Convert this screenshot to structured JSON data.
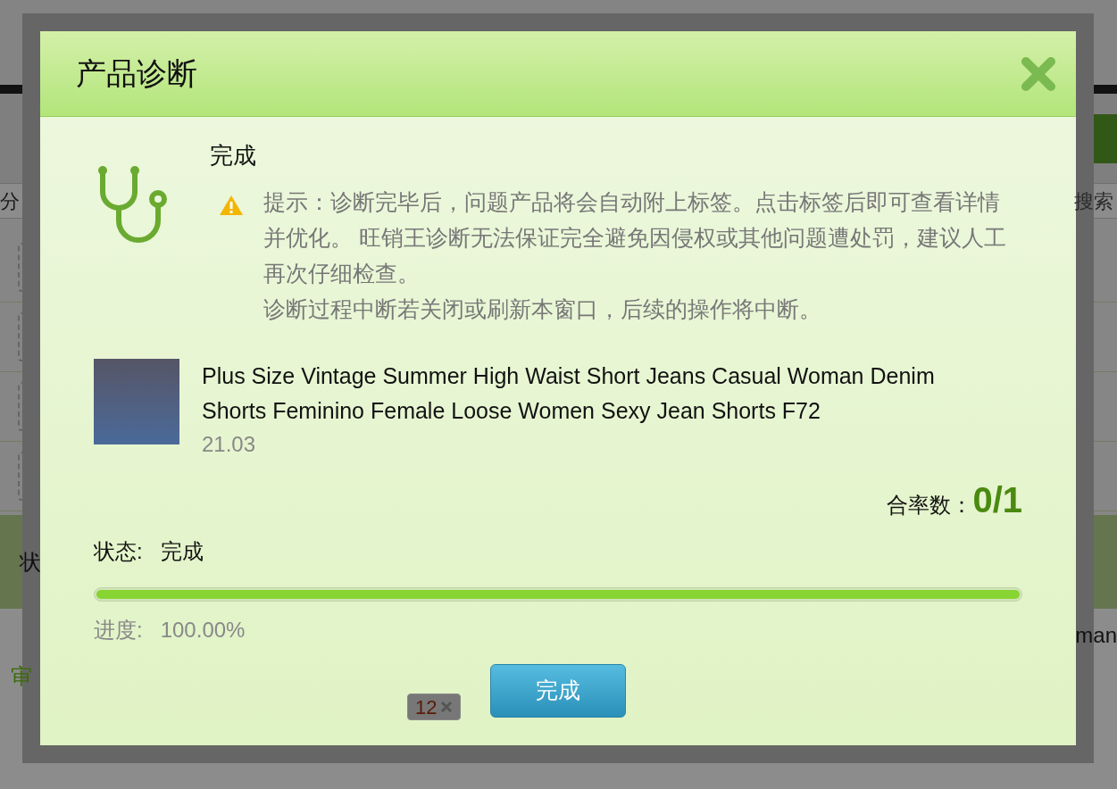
{
  "background": {
    "search_field": {
      "value": "分"
    },
    "search_button": "搜索",
    "header_cell": "状",
    "row_label": "审",
    "row_text": "man",
    "tag": {
      "label": "12"
    }
  },
  "dialog": {
    "title": "产品诊断",
    "status_heading": "完成",
    "notice": [
      "提示：诊断完毕后，问题产品将会自动附上标签。点击标签后即可查看详情并优化。 旺销王诊断无法保证完全避免因侵权或其他问题遭处罚，建议人工再次仔细检查。",
      "诊断过程中断若关闭或刷新本窗口，后续的操作将中断。"
    ],
    "product": {
      "title": "Plus Size Vintage Summer High Waist Short Jeans Casual Woman Denim Shorts Feminino Female Loose Women Sexy Jean Shorts F72",
      "price": "21.03"
    },
    "pass_label": "合率数：",
    "pass_value": "0/1",
    "status_label": "状态:",
    "status_value": "完成",
    "progress": {
      "level": 1
    },
    "progress_label": "进度:",
    "progress_value": "100.00%",
    "done_button": "完成"
  }
}
